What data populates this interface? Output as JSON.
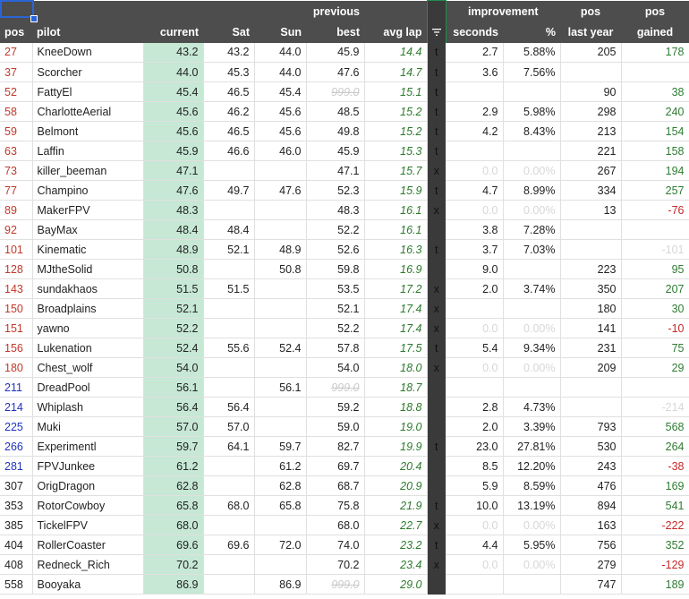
{
  "header": {
    "row1": {
      "previous": "previous",
      "improvement": "improvement",
      "pos_last": "pos",
      "pos_gained": "pos"
    },
    "row2": {
      "pos": "pos",
      "pilot": "pilot",
      "current": "current",
      "sat": "Sat",
      "sun": "Sun",
      "best": "best",
      "avg_lap": "avg lap",
      "seconds": "seconds",
      "percent": "%",
      "last_year": "last year",
      "gained": "gained"
    },
    "filter_icon": "filter-icon"
  },
  "colors": {
    "pos_red": "#c0392b",
    "pos_blue": "#2233bb",
    "current_fill": "#c6e8d4",
    "avg_green": "#2d7a2d",
    "gain_pos": "#2e7d32",
    "gain_neg": "#c62828"
  },
  "rows": [
    {
      "pos": "27",
      "pc": "red",
      "pilot": "KneeDown",
      "current": "43.2",
      "sat": "43.2",
      "sun": "44.0",
      "best": "45.9",
      "best_style": "",
      "avg": "14.4",
      "flag": "t",
      "sec": "2.7",
      "pct": "5.88%",
      "imp_style": "",
      "last": "205",
      "gained": "178",
      "gs": "pos"
    },
    {
      "pos": "37",
      "pc": "red",
      "pilot": "Scorcher",
      "current": "44.0",
      "sat": "45.3",
      "sun": "44.0",
      "best": "47.6",
      "best_style": "",
      "avg": "14.7",
      "flag": "t",
      "sec": "3.6",
      "pct": "7.56%",
      "imp_style": "",
      "last": "",
      "gained": "",
      "gs": "pos"
    },
    {
      "pos": "52",
      "pc": "red",
      "pilot": "FattyEl",
      "current": "45.4",
      "sat": "46.5",
      "sun": "45.4",
      "best": "999.0",
      "best_style": "strike",
      "avg": "15.1",
      "flag": "t",
      "sec": "",
      "pct": "",
      "imp_style": "",
      "last": "90",
      "gained": "38",
      "gs": "pos"
    },
    {
      "pos": "58",
      "pc": "red",
      "pilot": "CharlotteAerial",
      "current": "45.6",
      "sat": "46.2",
      "sun": "45.6",
      "best": "48.5",
      "best_style": "",
      "avg": "15.2",
      "flag": "t",
      "sec": "2.9",
      "pct": "5.98%",
      "imp_style": "",
      "last": "298",
      "gained": "240",
      "gs": "pos"
    },
    {
      "pos": "59",
      "pc": "red",
      "pilot": "Belmont",
      "current": "45.6",
      "sat": "46.5",
      "sun": "45.6",
      "best": "49.8",
      "best_style": "",
      "avg": "15.2",
      "flag": "t",
      "sec": "4.2",
      "pct": "8.43%",
      "imp_style": "",
      "last": "213",
      "gained": "154",
      "gs": "pos"
    },
    {
      "pos": "63",
      "pc": "red",
      "pilot": "Laffin",
      "current": "45.9",
      "sat": "46.6",
      "sun": "46.0",
      "best": "45.9",
      "best_style": "",
      "avg": "15.3",
      "flag": "t",
      "sec": "",
      "pct": "",
      "imp_style": "",
      "last": "221",
      "gained": "158",
      "gs": "pos"
    },
    {
      "pos": "73",
      "pc": "red",
      "pilot": "killer_beeman",
      "current": "47.1",
      "sat": "",
      "sun": "",
      "best": "47.1",
      "best_style": "",
      "avg": "15.7",
      "flag": "x",
      "sec": "0.0",
      "pct": "0.00%",
      "imp_style": "gray",
      "last": "267",
      "gained": "194",
      "gs": "pos"
    },
    {
      "pos": "77",
      "pc": "red",
      "pilot": "Champino",
      "current": "47.6",
      "sat": "49.7",
      "sun": "47.6",
      "best": "52.3",
      "best_style": "",
      "avg": "15.9",
      "flag": "t",
      "sec": "4.7",
      "pct": "8.99%",
      "imp_style": "",
      "last": "334",
      "gained": "257",
      "gs": "pos"
    },
    {
      "pos": "89",
      "pc": "red",
      "pilot": "MakerFPV",
      "current": "48.3",
      "sat": "",
      "sun": "",
      "best": "48.3",
      "best_style": "",
      "avg": "16.1",
      "flag": "x",
      "sec": "0.0",
      "pct": "0.00%",
      "imp_style": "gray",
      "last": "13",
      "gained": "-76",
      "gs": "neg"
    },
    {
      "pos": "92",
      "pc": "red",
      "pilot": "BayMax",
      "current": "48.4",
      "sat": "48.4",
      "sun": "",
      "best": "52.2",
      "best_style": "",
      "avg": "16.1",
      "flag": "",
      "sec": "3.8",
      "pct": "7.28%",
      "imp_style": "",
      "last": "",
      "gained": "",
      "gs": "pos"
    },
    {
      "pos": "101",
      "pc": "red",
      "pilot": "Kinematic",
      "current": "48.9",
      "sat": "52.1",
      "sun": "48.9",
      "best": "52.6",
      "best_style": "",
      "avg": "16.3",
      "flag": "t",
      "sec": "3.7",
      "pct": "7.03%",
      "imp_style": "",
      "last": "",
      "gained": "-101",
      "gs": "gray"
    },
    {
      "pos": "128",
      "pc": "red",
      "pilot": "MJtheSolid",
      "current": "50.8",
      "sat": "",
      "sun": "50.8",
      "best": "59.8",
      "best_style": "",
      "avg": "16.9",
      "flag": "",
      "sec": "9.0",
      "pct": "",
      "imp_style": "",
      "last": "223",
      "gained": "95",
      "gs": "pos"
    },
    {
      "pos": "143",
      "pc": "red",
      "pilot": "sundakhaos",
      "current": "51.5",
      "sat": "51.5",
      "sun": "",
      "best": "53.5",
      "best_style": "",
      "avg": "17.2",
      "flag": "x",
      "sec": "2.0",
      "pct": "3.74%",
      "imp_style": "",
      "last": "350",
      "gained": "207",
      "gs": "pos"
    },
    {
      "pos": "150",
      "pc": "red",
      "pilot": "Broadplains",
      "current": "52.1",
      "sat": "",
      "sun": "",
      "best": "52.1",
      "best_style": "",
      "avg": "17.4",
      "flag": "x",
      "sec": "",
      "pct": "",
      "imp_style": "",
      "last": "180",
      "gained": "30",
      "gs": "pos"
    },
    {
      "pos": "151",
      "pc": "red",
      "pilot": "yawno",
      "current": "52.2",
      "sat": "",
      "sun": "",
      "best": "52.2",
      "best_style": "",
      "avg": "17.4",
      "flag": "x",
      "sec": "0.0",
      "pct": "0.00%",
      "imp_style": "gray",
      "last": "141",
      "gained": "-10",
      "gs": "neg"
    },
    {
      "pos": "156",
      "pc": "red",
      "pilot": "Lukenation",
      "current": "52.4",
      "sat": "55.6",
      "sun": "52.4",
      "best": "57.8",
      "best_style": "",
      "avg": "17.5",
      "flag": "t",
      "sec": "5.4",
      "pct": "9.34%",
      "imp_style": "",
      "last": "231",
      "gained": "75",
      "gs": "pos"
    },
    {
      "pos": "180",
      "pc": "red",
      "pilot": "Chest_wolf",
      "current": "54.0",
      "sat": "",
      "sun": "",
      "best": "54.0",
      "best_style": "",
      "avg": "18.0",
      "flag": "x",
      "sec": "0.0",
      "pct": "0.00%",
      "imp_style": "gray",
      "last": "209",
      "gained": "29",
      "gs": "pos"
    },
    {
      "pos": "211",
      "pc": "blue",
      "pilot": "DreadPool",
      "current": "56.1",
      "sat": "",
      "sun": "56.1",
      "best": "999.0",
      "best_style": "strike",
      "avg": "18.7",
      "flag": "",
      "sec": "",
      "pct": "",
      "imp_style": "",
      "last": "",
      "gained": "",
      "gs": "pos"
    },
    {
      "pos": "214",
      "pc": "blue",
      "pilot": "Whiplash",
      "current": "56.4",
      "sat": "56.4",
      "sun": "",
      "best": "59.2",
      "best_style": "",
      "avg": "18.8",
      "flag": "",
      "sec": "2.8",
      "pct": "4.73%",
      "imp_style": "",
      "last": "",
      "gained": "-214",
      "gs": "gray"
    },
    {
      "pos": "225",
      "pc": "blue",
      "pilot": "Muki",
      "current": "57.0",
      "sat": "57.0",
      "sun": "",
      "best": "59.0",
      "best_style": "",
      "avg": "19.0",
      "flag": "",
      "sec": "2.0",
      "pct": "3.39%",
      "imp_style": "",
      "last": "793",
      "gained": "568",
      "gs": "pos"
    },
    {
      "pos": "266",
      "pc": "blue",
      "pilot": "Experimentl",
      "current": "59.7",
      "sat": "64.1",
      "sun": "59.7",
      "best": "82.7",
      "best_style": "",
      "avg": "19.9",
      "flag": "t",
      "sec": "23.0",
      "pct": "27.81%",
      "imp_style": "",
      "last": "530",
      "gained": "264",
      "gs": "pos"
    },
    {
      "pos": "281",
      "pc": "blue",
      "pilot": "FPVJunkee",
      "current": "61.2",
      "sat": "",
      "sun": "61.2",
      "best": "69.7",
      "best_style": "",
      "avg": "20.4",
      "flag": "",
      "sec": "8.5",
      "pct": "12.20%",
      "imp_style": "",
      "last": "243",
      "gained": "-38",
      "gs": "neg"
    },
    {
      "pos": "307",
      "pc": "black",
      "pilot": "OrigDragon",
      "current": "62.8",
      "sat": "",
      "sun": "62.8",
      "best": "68.7",
      "best_style": "",
      "avg": "20.9",
      "flag": "",
      "sec": "5.9",
      "pct": "8.59%",
      "imp_style": "",
      "last": "476",
      "gained": "169",
      "gs": "pos"
    },
    {
      "pos": "353",
      "pc": "black",
      "pilot": "RotorCowboy",
      "current": "65.8",
      "sat": "68.0",
      "sun": "65.8",
      "best": "75.8",
      "best_style": "",
      "avg": "21.9",
      "flag": "t",
      "sec": "10.0",
      "pct": "13.19%",
      "imp_style": "",
      "last": "894",
      "gained": "541",
      "gs": "pos"
    },
    {
      "pos": "385",
      "pc": "black",
      "pilot": "TickelFPV",
      "current": "68.0",
      "sat": "",
      "sun": "",
      "best": "68.0",
      "best_style": "",
      "avg": "22.7",
      "flag": "x",
      "sec": "0.0",
      "pct": "0.00%",
      "imp_style": "gray",
      "last": "163",
      "gained": "-222",
      "gs": "neg"
    },
    {
      "pos": "404",
      "pc": "black",
      "pilot": "RollerCoaster",
      "current": "69.6",
      "sat": "69.6",
      "sun": "72.0",
      "best": "74.0",
      "best_style": "",
      "avg": "23.2",
      "flag": "t",
      "sec": "4.4",
      "pct": "5.95%",
      "imp_style": "",
      "last": "756",
      "gained": "352",
      "gs": "pos"
    },
    {
      "pos": "408",
      "pc": "black",
      "pilot": "Redneck_Rich",
      "current": "70.2",
      "sat": "",
      "sun": "",
      "best": "70.2",
      "best_style": "",
      "avg": "23.4",
      "flag": "x",
      "sec": "0.0",
      "pct": "0.00%",
      "imp_style": "gray",
      "last": "279",
      "gained": "-129",
      "gs": "neg"
    },
    {
      "pos": "558",
      "pc": "black",
      "pilot": "Booyaka",
      "current": "86.9",
      "sat": "",
      "sun": "86.9",
      "best": "999.0",
      "best_style": "strike",
      "avg": "29.0",
      "flag": "",
      "sec": "",
      "pct": "",
      "imp_style": "",
      "last": "747",
      "gained": "189",
      "gs": "pos"
    }
  ]
}
